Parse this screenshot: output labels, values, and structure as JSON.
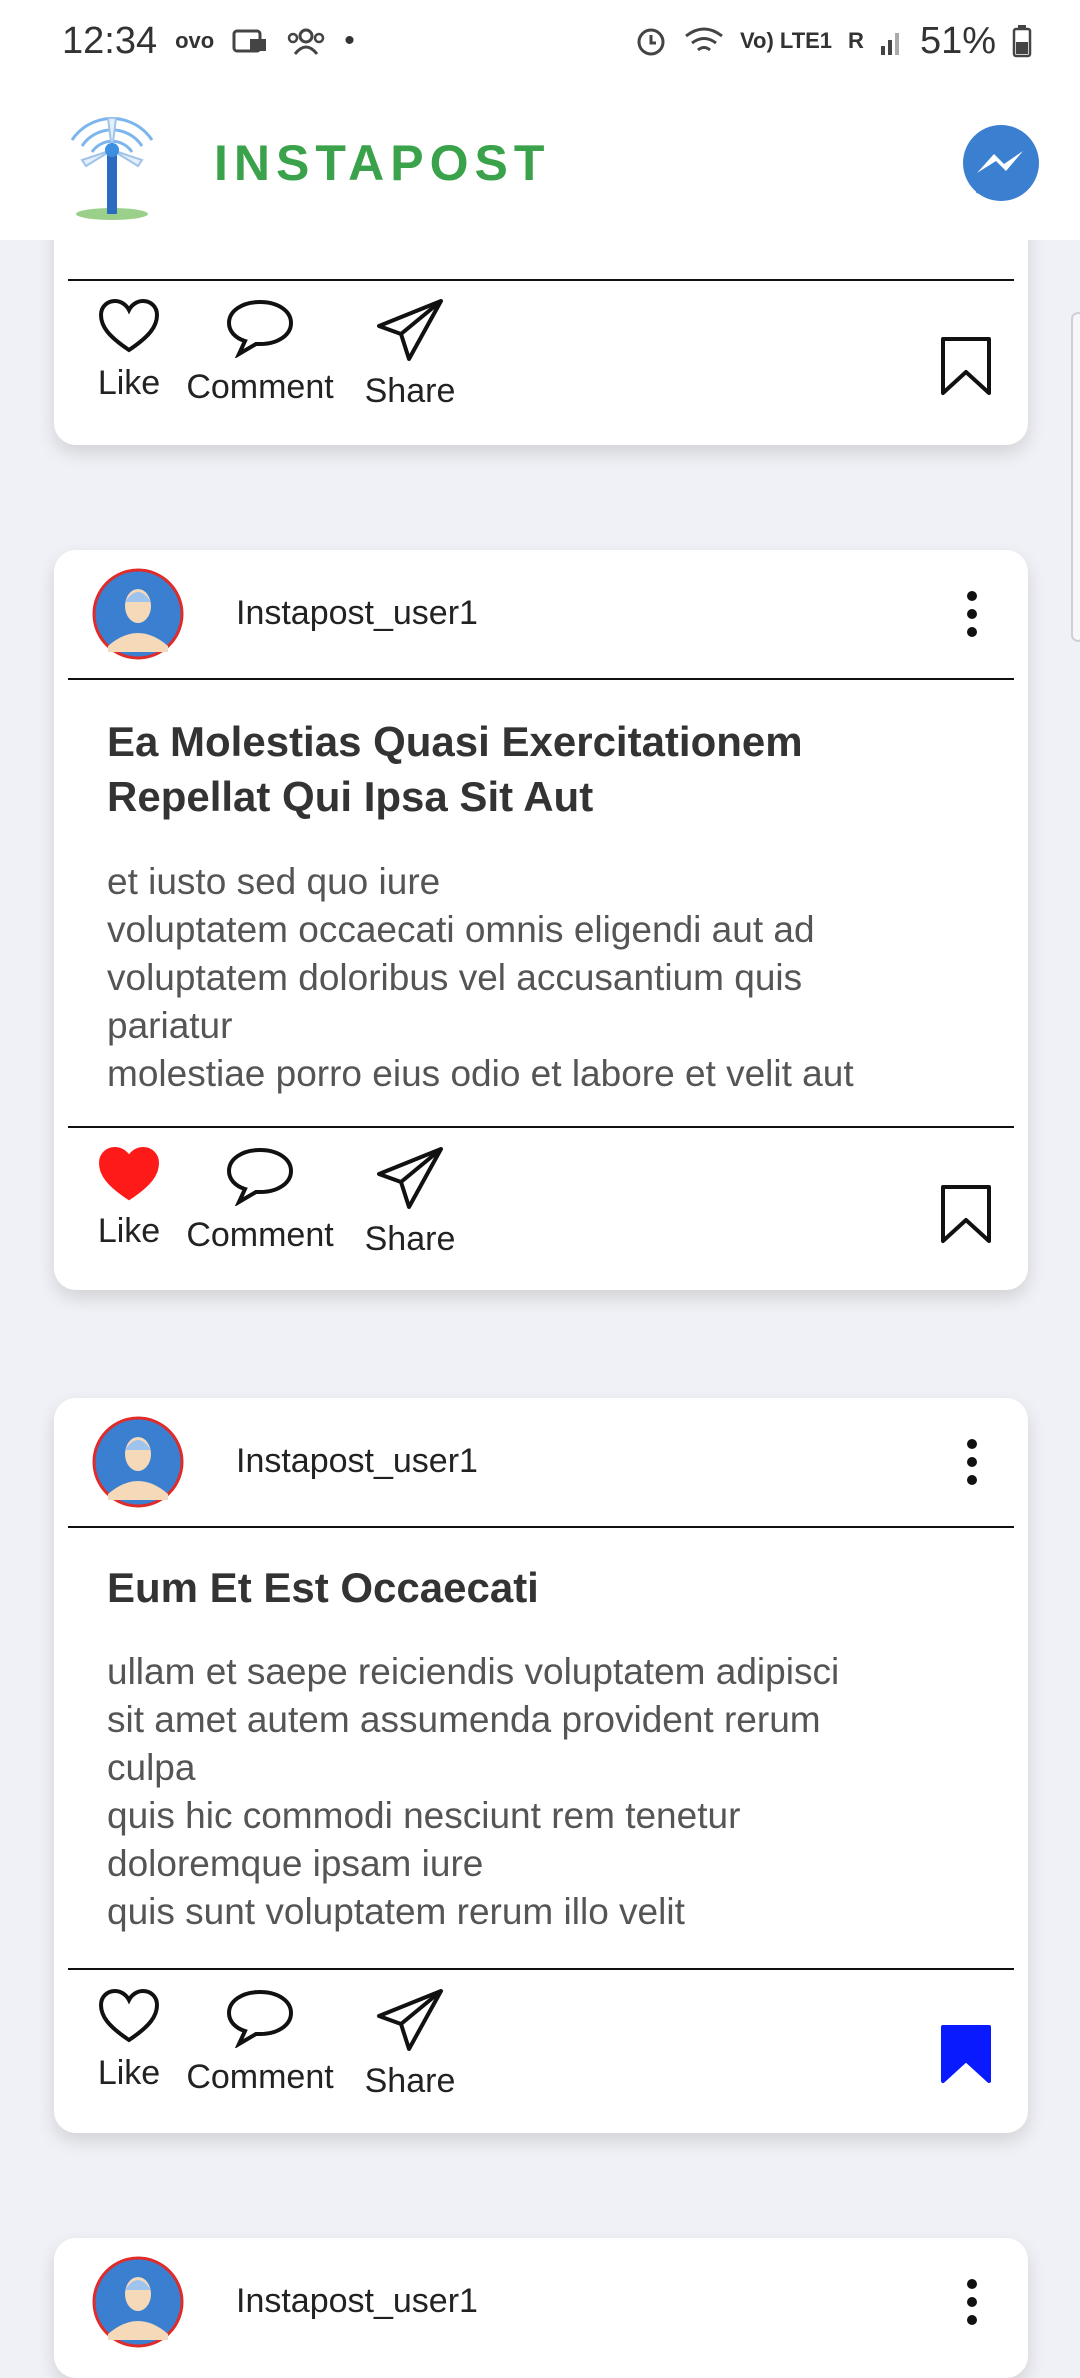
{
  "status_bar": {
    "time": "12:34",
    "left_icons": [
      "ovo-icon",
      "notification-icon",
      "group-icon"
    ],
    "network_label": "Vo) LTE1",
    "roaming": "R",
    "battery": "51%"
  },
  "app": {
    "title": "INSTAPOST",
    "brand_color": "#3aa24a"
  },
  "action_labels": {
    "like": "Like",
    "comment": "Comment",
    "share": "Share"
  },
  "posts": [
    {
      "liked": false,
      "bookmarked": false
    },
    {
      "username": "Instapost_user1",
      "title_lines": [
        "Ea Molestias Quasi Exercitationem",
        "Repellat Qui Ipsa Sit Aut"
      ],
      "body_lines": [
        "et iusto sed quo iure",
        "voluptatem occaecati omnis eligendi aut ad",
        "voluptatem doloribus vel accusantium quis",
        "pariatur",
        "molestiae porro eius odio et labore et velit aut"
      ],
      "liked": true,
      "bookmarked": false
    },
    {
      "username": "Instapost_user1",
      "title_lines": [
        "Eum Et Est Occaecati"
      ],
      "body_lines": [
        "ullam et saepe reiciendis voluptatem adipisci",
        "sit amet autem assumenda provident rerum",
        "culpa",
        "quis hic commodi nesciunt rem tenetur",
        "doloremque ipsam iure",
        "quis sunt voluptatem rerum illo velit"
      ],
      "liked": false,
      "bookmarked": true
    },
    {
      "username": "Instapost_user1"
    }
  ],
  "colors": {
    "like_active": "#ff1a1a",
    "bookmark_active": "#0a1aff",
    "avatar_blue": "#3b7fd0",
    "avatar_ring": "#e02b2b"
  }
}
